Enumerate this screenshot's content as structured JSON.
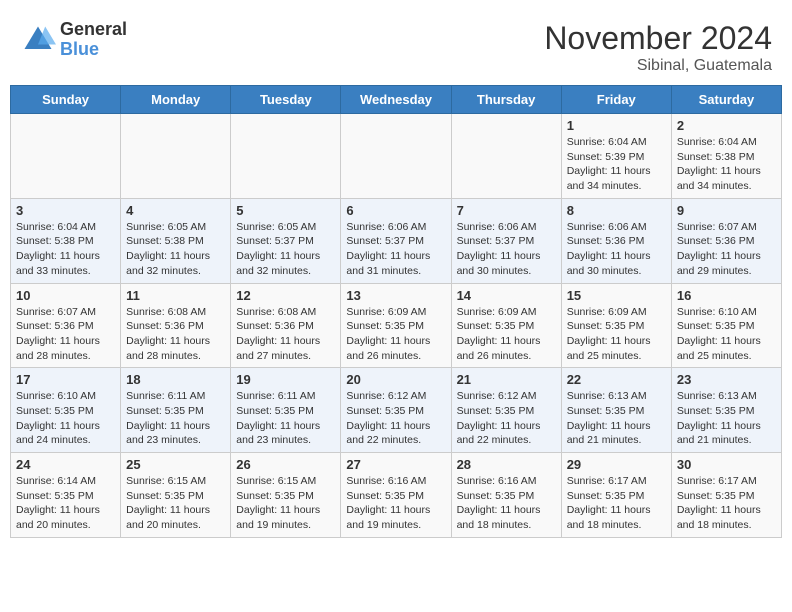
{
  "header": {
    "logo_general": "General",
    "logo_blue": "Blue",
    "month_title": "November 2024",
    "location": "Sibinal, Guatemala"
  },
  "weekdays": [
    "Sunday",
    "Monday",
    "Tuesday",
    "Wednesday",
    "Thursday",
    "Friday",
    "Saturday"
  ],
  "weeks": [
    [
      {
        "day": "",
        "info": ""
      },
      {
        "day": "",
        "info": ""
      },
      {
        "day": "",
        "info": ""
      },
      {
        "day": "",
        "info": ""
      },
      {
        "day": "",
        "info": ""
      },
      {
        "day": "1",
        "info": "Sunrise: 6:04 AM\nSunset: 5:39 PM\nDaylight: 11 hours and 34 minutes."
      },
      {
        "day": "2",
        "info": "Sunrise: 6:04 AM\nSunset: 5:38 PM\nDaylight: 11 hours and 34 minutes."
      }
    ],
    [
      {
        "day": "3",
        "info": "Sunrise: 6:04 AM\nSunset: 5:38 PM\nDaylight: 11 hours and 33 minutes."
      },
      {
        "day": "4",
        "info": "Sunrise: 6:05 AM\nSunset: 5:38 PM\nDaylight: 11 hours and 32 minutes."
      },
      {
        "day": "5",
        "info": "Sunrise: 6:05 AM\nSunset: 5:37 PM\nDaylight: 11 hours and 32 minutes."
      },
      {
        "day": "6",
        "info": "Sunrise: 6:06 AM\nSunset: 5:37 PM\nDaylight: 11 hours and 31 minutes."
      },
      {
        "day": "7",
        "info": "Sunrise: 6:06 AM\nSunset: 5:37 PM\nDaylight: 11 hours and 30 minutes."
      },
      {
        "day": "8",
        "info": "Sunrise: 6:06 AM\nSunset: 5:36 PM\nDaylight: 11 hours and 30 minutes."
      },
      {
        "day": "9",
        "info": "Sunrise: 6:07 AM\nSunset: 5:36 PM\nDaylight: 11 hours and 29 minutes."
      }
    ],
    [
      {
        "day": "10",
        "info": "Sunrise: 6:07 AM\nSunset: 5:36 PM\nDaylight: 11 hours and 28 minutes."
      },
      {
        "day": "11",
        "info": "Sunrise: 6:08 AM\nSunset: 5:36 PM\nDaylight: 11 hours and 28 minutes."
      },
      {
        "day": "12",
        "info": "Sunrise: 6:08 AM\nSunset: 5:36 PM\nDaylight: 11 hours and 27 minutes."
      },
      {
        "day": "13",
        "info": "Sunrise: 6:09 AM\nSunset: 5:35 PM\nDaylight: 11 hours and 26 minutes."
      },
      {
        "day": "14",
        "info": "Sunrise: 6:09 AM\nSunset: 5:35 PM\nDaylight: 11 hours and 26 minutes."
      },
      {
        "day": "15",
        "info": "Sunrise: 6:09 AM\nSunset: 5:35 PM\nDaylight: 11 hours and 25 minutes."
      },
      {
        "day": "16",
        "info": "Sunrise: 6:10 AM\nSunset: 5:35 PM\nDaylight: 11 hours and 25 minutes."
      }
    ],
    [
      {
        "day": "17",
        "info": "Sunrise: 6:10 AM\nSunset: 5:35 PM\nDaylight: 11 hours and 24 minutes."
      },
      {
        "day": "18",
        "info": "Sunrise: 6:11 AM\nSunset: 5:35 PM\nDaylight: 11 hours and 23 minutes."
      },
      {
        "day": "19",
        "info": "Sunrise: 6:11 AM\nSunset: 5:35 PM\nDaylight: 11 hours and 23 minutes."
      },
      {
        "day": "20",
        "info": "Sunrise: 6:12 AM\nSunset: 5:35 PM\nDaylight: 11 hours and 22 minutes."
      },
      {
        "day": "21",
        "info": "Sunrise: 6:12 AM\nSunset: 5:35 PM\nDaylight: 11 hours and 22 minutes."
      },
      {
        "day": "22",
        "info": "Sunrise: 6:13 AM\nSunset: 5:35 PM\nDaylight: 11 hours and 21 minutes."
      },
      {
        "day": "23",
        "info": "Sunrise: 6:13 AM\nSunset: 5:35 PM\nDaylight: 11 hours and 21 minutes."
      }
    ],
    [
      {
        "day": "24",
        "info": "Sunrise: 6:14 AM\nSunset: 5:35 PM\nDaylight: 11 hours and 20 minutes."
      },
      {
        "day": "25",
        "info": "Sunrise: 6:15 AM\nSunset: 5:35 PM\nDaylight: 11 hours and 20 minutes."
      },
      {
        "day": "26",
        "info": "Sunrise: 6:15 AM\nSunset: 5:35 PM\nDaylight: 11 hours and 19 minutes."
      },
      {
        "day": "27",
        "info": "Sunrise: 6:16 AM\nSunset: 5:35 PM\nDaylight: 11 hours and 19 minutes."
      },
      {
        "day": "28",
        "info": "Sunrise: 6:16 AM\nSunset: 5:35 PM\nDaylight: 11 hours and 18 minutes."
      },
      {
        "day": "29",
        "info": "Sunrise: 6:17 AM\nSunset: 5:35 PM\nDaylight: 11 hours and 18 minutes."
      },
      {
        "day": "30",
        "info": "Sunrise: 6:17 AM\nSunset: 5:35 PM\nDaylight: 11 hours and 18 minutes."
      }
    ]
  ]
}
